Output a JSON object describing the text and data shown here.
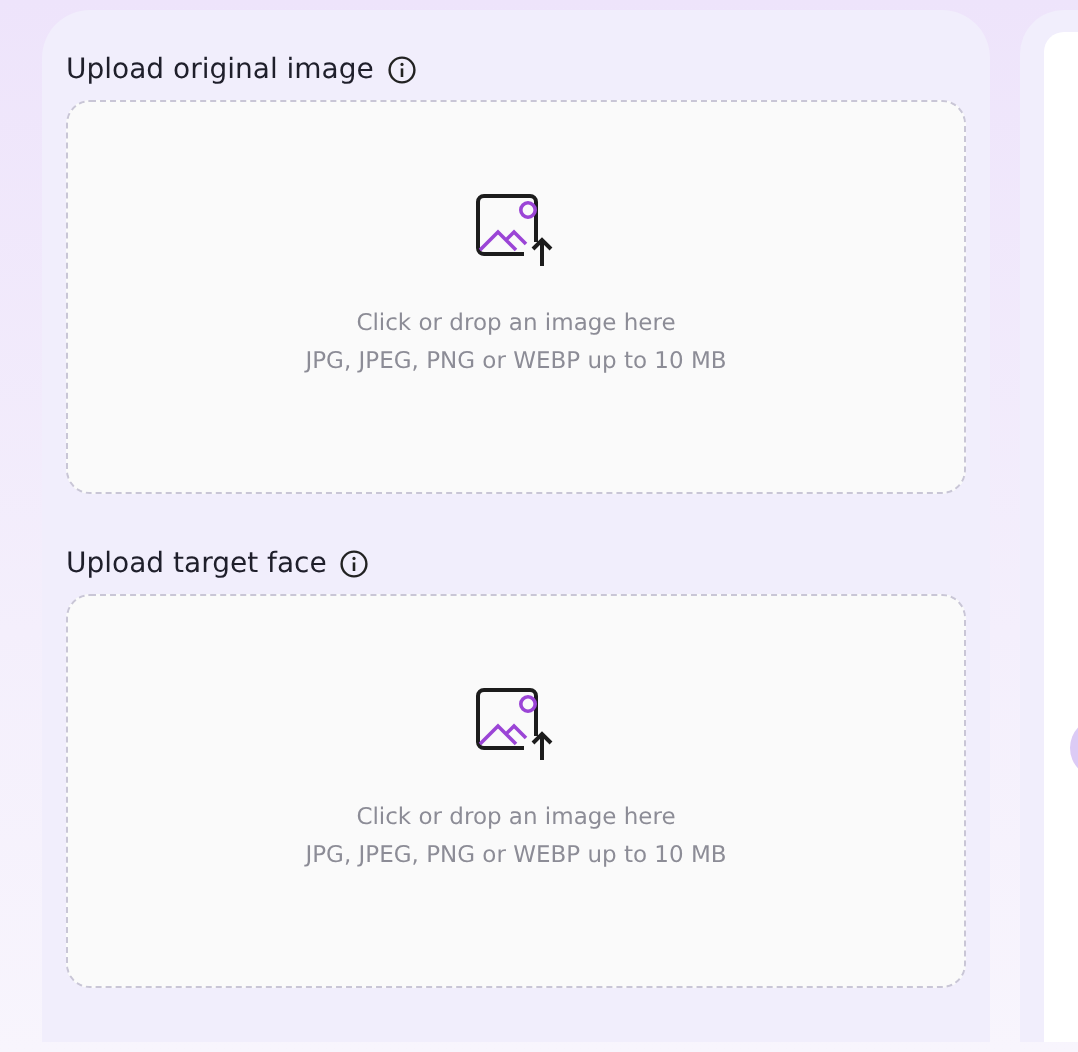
{
  "uploads": [
    {
      "label": "Upload original image",
      "prompt": "Click or drop an image here",
      "formats": "JPG, JPEG, PNG or WEBP up to 10 MB"
    },
    {
      "label": "Upload target face",
      "prompt": "Click or drop an image here",
      "formats": "JPG, JPEG, PNG or WEBP up to 10 MB"
    }
  ]
}
